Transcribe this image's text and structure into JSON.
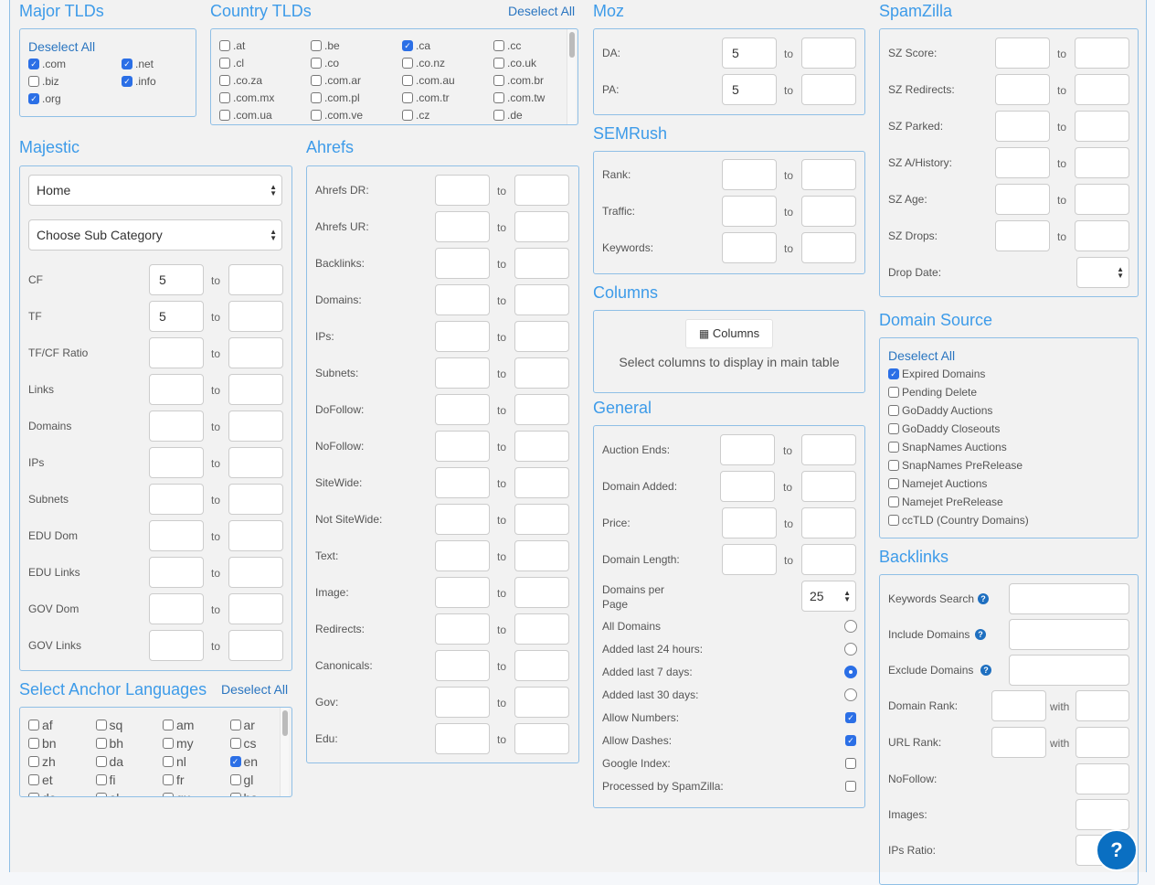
{
  "major_tlds": {
    "title": "Major TLDs",
    "deselect": "Deselect All",
    "items": [
      {
        "label": ".com",
        "checked": true
      },
      {
        "label": ".net",
        "checked": true
      },
      {
        "label": ".biz",
        "checked": false
      },
      {
        "label": ".info",
        "checked": true
      },
      {
        "label": ".org",
        "checked": true
      }
    ]
  },
  "country_tlds": {
    "title": "Country TLDs",
    "deselect": "Deselect All",
    "items": [
      {
        "label": ".at",
        "checked": false
      },
      {
        "label": ".be",
        "checked": false
      },
      {
        "label": ".ca",
        "checked": true
      },
      {
        "label": ".cc",
        "checked": false
      },
      {
        "label": ".cl",
        "checked": false
      },
      {
        "label": ".co",
        "checked": false
      },
      {
        "label": ".co.nz",
        "checked": false
      },
      {
        "label": ".co.uk",
        "checked": false
      },
      {
        "label": ".co.za",
        "checked": false
      },
      {
        "label": ".com.ar",
        "checked": false
      },
      {
        "label": ".com.au",
        "checked": false
      },
      {
        "label": ".com.br",
        "checked": false
      },
      {
        "label": ".com.mx",
        "checked": false
      },
      {
        "label": ".com.pl",
        "checked": false
      },
      {
        "label": ".com.tr",
        "checked": false
      },
      {
        "label": ".com.tw",
        "checked": false
      },
      {
        "label": ".com.ua",
        "checked": false
      },
      {
        "label": ".com.ve",
        "checked": false
      },
      {
        "label": ".cz",
        "checked": false
      },
      {
        "label": ".de",
        "checked": false
      }
    ]
  },
  "majestic": {
    "title": "Majestic",
    "category": "Home",
    "subcategory": "Choose Sub Category",
    "to": "to",
    "rows": [
      {
        "label": "CF",
        "from": "5",
        "to": ""
      },
      {
        "label": "TF",
        "from": "5",
        "to": ""
      },
      {
        "label": "TF/CF Ratio",
        "from": "",
        "to": ""
      },
      {
        "label": "Links",
        "from": "",
        "to": ""
      },
      {
        "label": "Domains",
        "from": "",
        "to": ""
      },
      {
        "label": "IPs",
        "from": "",
        "to": ""
      },
      {
        "label": "Subnets",
        "from": "",
        "to": ""
      },
      {
        "label": "EDU Dom",
        "from": "",
        "to": ""
      },
      {
        "label": "EDU Links",
        "from": "",
        "to": ""
      },
      {
        "label": "GOV Dom",
        "from": "",
        "to": ""
      },
      {
        "label": "GOV Links",
        "from": "",
        "to": ""
      }
    ]
  },
  "anchor_languages": {
    "title": "Select Anchor Languages",
    "deselect": "Deselect All",
    "items": [
      {
        "label": "af",
        "checked": false
      },
      {
        "label": "sq",
        "checked": false
      },
      {
        "label": "am",
        "checked": false
      },
      {
        "label": "ar",
        "checked": false
      },
      {
        "label": "bn",
        "checked": false
      },
      {
        "label": "bh",
        "checked": false
      },
      {
        "label": "my",
        "checked": false
      },
      {
        "label": "cs",
        "checked": false
      },
      {
        "label": "zh",
        "checked": false
      },
      {
        "label": "da",
        "checked": false
      },
      {
        "label": "nl",
        "checked": false
      },
      {
        "label": "en",
        "checked": true
      },
      {
        "label": "et",
        "checked": false
      },
      {
        "label": "fi",
        "checked": false
      },
      {
        "label": "fr",
        "checked": false
      },
      {
        "label": "gl",
        "checked": false
      },
      {
        "label": "de",
        "checked": false
      },
      {
        "label": "el",
        "checked": false
      },
      {
        "label": "gu",
        "checked": false
      },
      {
        "label": "ha",
        "checked": false
      }
    ]
  },
  "ahrefs": {
    "title": "Ahrefs",
    "to": "to",
    "rows": [
      {
        "label": "Ahrefs DR:"
      },
      {
        "label": "Ahrefs UR:"
      },
      {
        "label": "Backlinks:"
      },
      {
        "label": "Domains:"
      },
      {
        "label": "IPs:"
      },
      {
        "label": "Subnets:"
      },
      {
        "label": "DoFollow:"
      },
      {
        "label": "NoFollow:"
      },
      {
        "label": "SiteWide:"
      },
      {
        "label": "Not SiteWide:"
      },
      {
        "label": "Text:"
      },
      {
        "label": "Image:"
      },
      {
        "label": "Redirects:"
      },
      {
        "label": "Canonicals:"
      },
      {
        "label": "Gov:"
      },
      {
        "label": "Edu:"
      }
    ]
  },
  "moz": {
    "title": "Moz",
    "to": "to",
    "rows": [
      {
        "label": "DA:",
        "from": "5",
        "to": ""
      },
      {
        "label": "PA:",
        "from": "5",
        "to": ""
      }
    ]
  },
  "semrush": {
    "title": "SEMRush",
    "to": "to",
    "rows": [
      {
        "label": "Rank:"
      },
      {
        "label": "Traffic:"
      },
      {
        "label": "Keywords:"
      }
    ]
  },
  "columns": {
    "title": "Columns",
    "button": "Columns",
    "hint": "Select columns to display in main table"
  },
  "general": {
    "title": "General",
    "to": "to",
    "ranges": [
      {
        "label": "Auction Ends:"
      },
      {
        "label": "Domain Added:"
      },
      {
        "label": "Price:"
      },
      {
        "label": "Domain Length:"
      }
    ],
    "per_page_label": "Domains per Page",
    "per_page": "25",
    "radios": [
      {
        "label": "All Domains",
        "checked": false
      },
      {
        "label": "Added last 24 hours:",
        "checked": false
      },
      {
        "label": "Added last 7 days:",
        "checked": true
      },
      {
        "label": "Added last 30 days:",
        "checked": false
      }
    ],
    "checks": [
      {
        "label": "Allow Numbers:",
        "checked": true
      },
      {
        "label": "Allow Dashes:",
        "checked": true
      },
      {
        "label": "Google Index:",
        "checked": false
      },
      {
        "label": "Processed by SpamZilla:",
        "checked": false
      }
    ]
  },
  "spamzilla": {
    "title": "SpamZilla",
    "to": "to",
    "rows": [
      {
        "label": "SZ Score:"
      },
      {
        "label": "SZ Redirects:"
      },
      {
        "label": "SZ Parked:"
      },
      {
        "label": "SZ A/History:"
      },
      {
        "label": "SZ Age:"
      },
      {
        "label": "SZ Drops:"
      }
    ],
    "drop_date_label": "Drop Date:",
    "drop_date": ""
  },
  "domain_source": {
    "title": "Domain Source",
    "deselect": "Deselect All",
    "items": [
      {
        "label": "Expired Domains",
        "checked": true
      },
      {
        "label": "Pending Delete",
        "checked": false
      },
      {
        "label": "GoDaddy Auctions",
        "checked": false
      },
      {
        "label": "GoDaddy Closeouts",
        "checked": false
      },
      {
        "label": "SnapNames Auctions",
        "checked": false
      },
      {
        "label": "SnapNames PreRelease",
        "checked": false
      },
      {
        "label": "Namejet Auctions",
        "checked": false
      },
      {
        "label": "Namejet PreRelease",
        "checked": false
      },
      {
        "label": "ccTLD (Country Domains)",
        "checked": false
      }
    ]
  },
  "backlinks": {
    "title": "Backlinks",
    "with": "with",
    "text_rows": [
      {
        "label": "Keywords Search"
      },
      {
        "label": "Include Domains"
      },
      {
        "label": "Exclude Domains"
      }
    ],
    "with_rows": [
      {
        "label": "Domain Rank:"
      },
      {
        "label": "URL Rank:"
      }
    ],
    "single_rows": [
      {
        "label": "NoFollow:"
      },
      {
        "label": "Images:"
      },
      {
        "label": "IPs Ratio:"
      }
    ]
  },
  "help_button": "?"
}
